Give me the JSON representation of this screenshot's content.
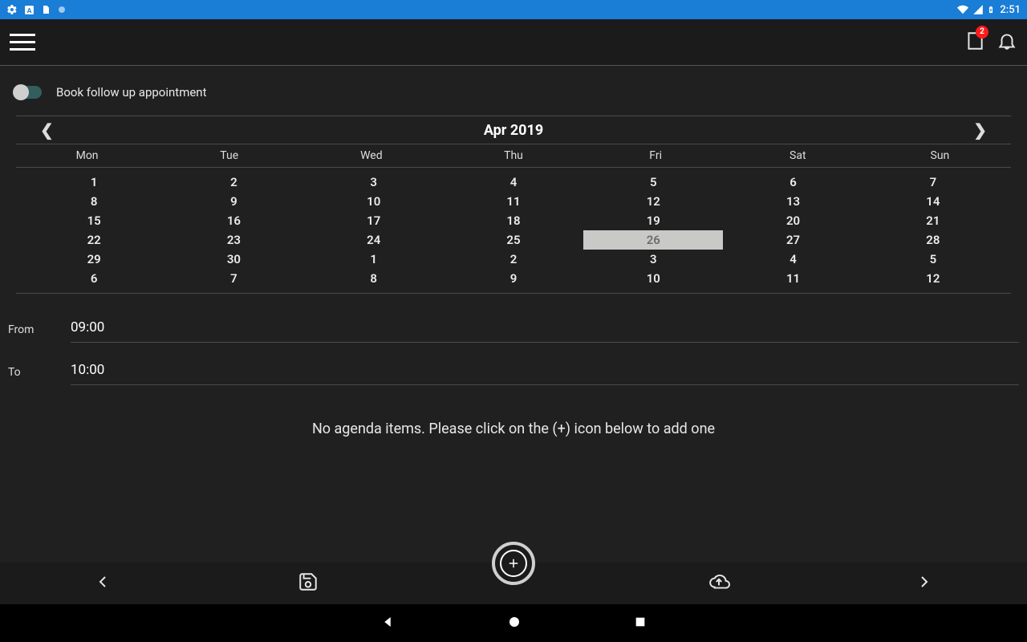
{
  "status": {
    "time": "2:51"
  },
  "header": {
    "badge": "2"
  },
  "toggle": {
    "label": "Book follow up appointment"
  },
  "calendar": {
    "title": "Apr 2019",
    "days": [
      "Mon",
      "Tue",
      "Wed",
      "Thu",
      "Fri",
      "Sat",
      "Sun"
    ],
    "rows": [
      [
        "1",
        "2",
        "3",
        "4",
        "5",
        "6",
        "7"
      ],
      [
        "8",
        "9",
        "10",
        "11",
        "12",
        "13",
        "14"
      ],
      [
        "15",
        "16",
        "17",
        "18",
        "19",
        "20",
        "21"
      ],
      [
        "22",
        "23",
        "24",
        "25",
        "26",
        "27",
        "28"
      ],
      [
        "29",
        "30",
        "1",
        "2",
        "3",
        "4",
        "5"
      ],
      [
        "6",
        "7",
        "8",
        "9",
        "10",
        "11",
        "12"
      ]
    ],
    "selected": "26"
  },
  "time": {
    "from_label": "From",
    "from_value": "09:00",
    "to_label": "To",
    "to_value": "10:00"
  },
  "agenda": {
    "empty": "No agenda items. Please click on the (+) icon below to add one"
  }
}
